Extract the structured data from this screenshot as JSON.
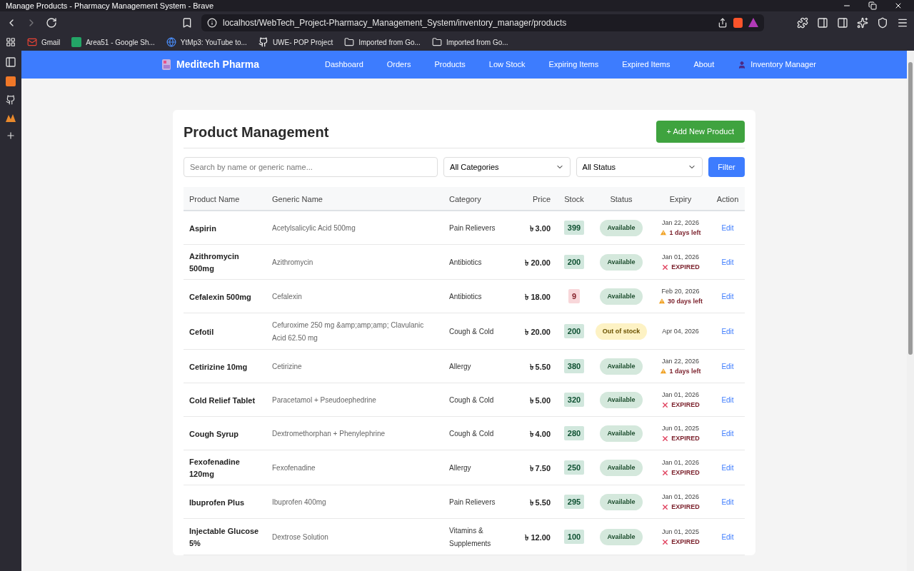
{
  "window": {
    "title": "Manage Products - Pharmacy Management System - Brave"
  },
  "address_bar": {
    "url": "localhost/WebTech_Project-Pharmacy_Management_System/inventory_manager/products"
  },
  "bookmarks": [
    {
      "label": "Gmail",
      "kind": "mail"
    },
    {
      "label": "Area51 - Google Sh...",
      "kind": "sheet"
    },
    {
      "label": "YtMp3: YouTube to...",
      "kind": "web"
    },
    {
      "label": "UWE- POP Project",
      "kind": "github"
    },
    {
      "label": "Imported from Go...",
      "kind": "folder"
    },
    {
      "label": "Imported from Go...",
      "kind": "folder"
    }
  ],
  "navbar": {
    "brand": "Meditech Pharma",
    "items": [
      {
        "label": "Dashboard",
        "kind": "link"
      },
      {
        "label": "Orders",
        "kind": "link"
      },
      {
        "label": "Products",
        "kind": "link"
      },
      {
        "label": "Low Stock",
        "kind": "link"
      },
      {
        "label": "Expiring Items",
        "kind": "link"
      },
      {
        "label": "Expired Items",
        "kind": "link"
      },
      {
        "label": "About",
        "kind": "link"
      },
      {
        "label": "Inventory Manager",
        "kind": "user"
      }
    ]
  },
  "page": {
    "title": "Product Management",
    "add_button": "+ Add New Product"
  },
  "filters": {
    "search": {
      "placeholder": "Search by name or generic name..."
    },
    "category": "All Categories",
    "status": "All Status",
    "button": "Filter"
  },
  "table": {
    "columns": [
      "Product Name",
      "Generic Name",
      "Category",
      "Price",
      "Stock",
      "Status",
      "Expiry",
      "Action"
    ],
    "rows": [
      {
        "name": "Aspirin",
        "generic": "Acetylsalicylic Acid 500mg",
        "category": "Pain Relievers",
        "price": "৳ 3.00",
        "stock": "399",
        "low_stock": false,
        "status": {
          "label": "Available",
          "kind": "available"
        },
        "expiry": "Jan 22, 2026",
        "expiry_note": {
          "kind": "warning",
          "text": "1 days left"
        },
        "action": "Edit"
      },
      {
        "name": "Azithromycin 500mg",
        "generic": "Azithromycin",
        "category": "Antibiotics",
        "price": "৳ 20.00",
        "stock": "200",
        "low_stock": false,
        "status": {
          "label": "Available",
          "kind": "available"
        },
        "expiry": "Jan 01, 2026",
        "expiry_note": {
          "kind": "expired",
          "text": "EXPIRED"
        },
        "action": "Edit"
      },
      {
        "name": "Cefalexin 500mg",
        "generic": "Cefalexin",
        "category": "Antibiotics",
        "price": "৳ 18.00",
        "stock": "9",
        "low_stock": true,
        "status": {
          "label": "Available",
          "kind": "available"
        },
        "expiry": "Feb 20, 2026",
        "expiry_note": {
          "kind": "warning",
          "text": "30 days left"
        },
        "action": "Edit"
      },
      {
        "name": "Cefotil",
        "generic": "Cefuroxime 250 mg &amp;amp;amp; Clavulanic Acid 62.50 mg",
        "category": "Cough & Cold",
        "price": "৳ 20.00",
        "stock": "200",
        "low_stock": false,
        "status": {
          "label": "Out of stock",
          "kind": "out"
        },
        "expiry": "Apr 04, 2026",
        "action": "Edit"
      },
      {
        "name": "Cetirizine 10mg",
        "generic": "Cetirizine",
        "category": "Allergy",
        "price": "৳ 5.50",
        "stock": "380",
        "low_stock": false,
        "status": {
          "label": "Available",
          "kind": "available"
        },
        "expiry": "Jan 22, 2026",
        "expiry_note": {
          "kind": "warning",
          "text": "1 days left"
        },
        "action": "Edit"
      },
      {
        "name": "Cold Relief Tablet",
        "generic": "Paracetamol + Pseudoephedrine",
        "category": "Cough & Cold",
        "price": "৳ 5.00",
        "stock": "320",
        "low_stock": false,
        "status": {
          "label": "Available",
          "kind": "available"
        },
        "expiry": "Jan 01, 2026",
        "expiry_note": {
          "kind": "expired",
          "text": "EXPIRED"
        },
        "action": "Edit"
      },
      {
        "name": "Cough Syrup",
        "generic": "Dextromethorphan + Phenylephrine",
        "category": "Cough & Cold",
        "price": "৳ 4.00",
        "stock": "280",
        "low_stock": false,
        "status": {
          "label": "Available",
          "kind": "available"
        },
        "expiry": "Jun 01, 2025",
        "expiry_note": {
          "kind": "expired",
          "text": "EXPIRED"
        },
        "action": "Edit"
      },
      {
        "name": "Fexofenadine 120mg",
        "generic": "Fexofenadine",
        "category": "Allergy",
        "price": "৳ 7.50",
        "stock": "250",
        "low_stock": false,
        "status": {
          "label": "Available",
          "kind": "available"
        },
        "expiry": "Jan 01, 2026",
        "expiry_note": {
          "kind": "expired",
          "text": "EXPIRED"
        },
        "action": "Edit"
      },
      {
        "name": "Ibuprofen Plus",
        "generic": "Ibuprofen 400mg",
        "category": "Pain Relievers",
        "price": "৳ 5.50",
        "stock": "295",
        "low_stock": false,
        "status": {
          "label": "Available",
          "kind": "available"
        },
        "expiry": "Jan 01, 2026",
        "expiry_note": {
          "kind": "expired",
          "text": "EXPIRED"
        },
        "action": "Edit"
      },
      {
        "name": "Injectable Glucose 5%",
        "generic": "Dextrose Solution",
        "category": "Vitamins & Supplements",
        "price": "৳ 12.00",
        "stock": "100",
        "low_stock": false,
        "status": {
          "label": "Available",
          "kind": "available"
        },
        "expiry": "Jun 01, 2025",
        "expiry_note": {
          "kind": "expired",
          "text": "EXPIRED"
        },
        "action": "Edit"
      }
    ]
  }
}
